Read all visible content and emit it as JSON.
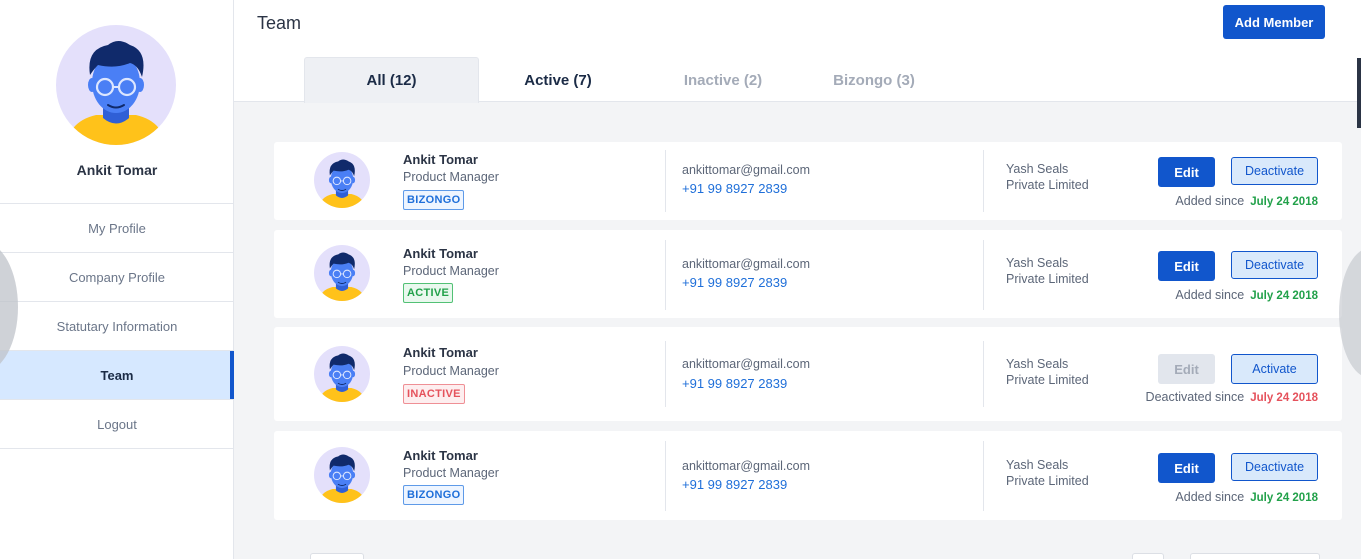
{
  "sidebar": {
    "user_name": "Ankit Tomar",
    "items": [
      {
        "label": "My Profile"
      },
      {
        "label": "Company Profile"
      },
      {
        "label": "Statutary Information"
      },
      {
        "label": "Team"
      },
      {
        "label": "Logout"
      }
    ]
  },
  "header": {
    "title": "Team",
    "add_button": "Add Member",
    "tabs": [
      {
        "label": "All (12)"
      },
      {
        "label": "Active (7)"
      },
      {
        "label": "Inactive (2)"
      },
      {
        "label": "Bizongo (3)"
      }
    ]
  },
  "members": [
    {
      "name": "Ankit Tomar",
      "role": "Product Manager",
      "badge": "BIZONGO",
      "email": "ankittomar@gmail.com",
      "phone": "+91 99 8927 2839",
      "company_line1": "Yash Seals",
      "company_line2": "Private Limited",
      "edit_label": "Edit",
      "action_label": "Deactivate",
      "since_label": "Added since",
      "since_date": "July 24 2018"
    },
    {
      "name": "Ankit Tomar",
      "role": "Product Manager",
      "badge": "ACTIVE",
      "email": "ankittomar@gmail.com",
      "phone": "+91 99 8927 2839",
      "company_line1": "Yash Seals",
      "company_line2": "Private Limited",
      "edit_label": "Edit",
      "action_label": "Deactivate",
      "since_label": "Added since",
      "since_date": "July 24 2018"
    },
    {
      "name": "Ankit Tomar",
      "role": "Product Manager",
      "badge": "INACTIVE",
      "email": "ankittomar@gmail.com",
      "phone": "+91 99 8927 2839",
      "company_line1": "Yash Seals",
      "company_line2": "Private Limited",
      "edit_label": "Edit",
      "action_label": "Activate",
      "since_label": "Deactivated since",
      "since_date": "July 24 2018"
    },
    {
      "name": "Ankit Tomar",
      "role": "Product Manager",
      "badge": "BIZONGO",
      "email": "ankittomar@gmail.com",
      "phone": "+91 99 8927 2839",
      "company_line1": "Yash Seals",
      "company_line2": "Private Limited",
      "edit_label": "Edit",
      "action_label": "Deactivate",
      "since_label": "Added since",
      "since_date": "July 24 2018"
    }
  ],
  "colors": {
    "primary": "#1156cc",
    "active_green": "#22a14a",
    "inactive_red": "#e5525c",
    "avatar_bg": "#e4e0fb",
    "avatar_face": "#4a7ff5",
    "avatar_shirt": "#ffc21a"
  }
}
